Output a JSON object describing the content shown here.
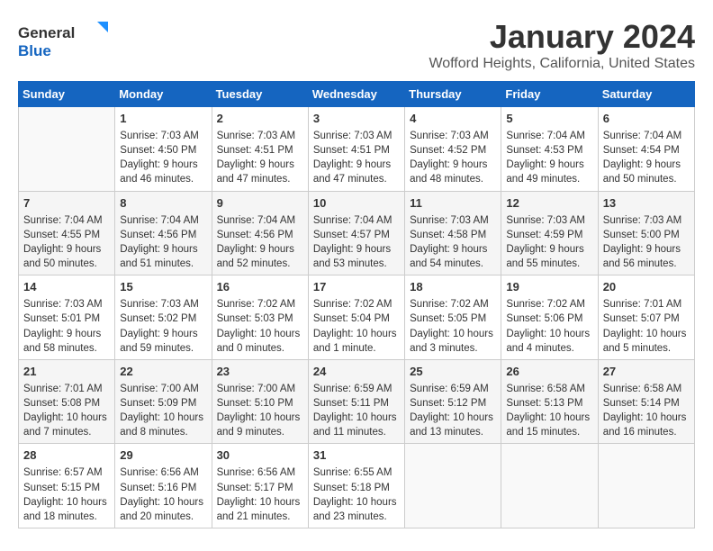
{
  "logo": {
    "general": "General",
    "blue": "Blue"
  },
  "header": {
    "title": "January 2024",
    "subtitle": "Wofford Heights, California, United States"
  },
  "weekdays": [
    "Sunday",
    "Monday",
    "Tuesday",
    "Wednesday",
    "Thursday",
    "Friday",
    "Saturday"
  ],
  "weeks": [
    [
      {
        "day": "",
        "content": ""
      },
      {
        "day": "1",
        "content": "Sunrise: 7:03 AM\nSunset: 4:50 PM\nDaylight: 9 hours\nand 46 minutes."
      },
      {
        "day": "2",
        "content": "Sunrise: 7:03 AM\nSunset: 4:51 PM\nDaylight: 9 hours\nand 47 minutes."
      },
      {
        "day": "3",
        "content": "Sunrise: 7:03 AM\nSunset: 4:51 PM\nDaylight: 9 hours\nand 47 minutes."
      },
      {
        "day": "4",
        "content": "Sunrise: 7:03 AM\nSunset: 4:52 PM\nDaylight: 9 hours\nand 48 minutes."
      },
      {
        "day": "5",
        "content": "Sunrise: 7:04 AM\nSunset: 4:53 PM\nDaylight: 9 hours\nand 49 minutes."
      },
      {
        "day": "6",
        "content": "Sunrise: 7:04 AM\nSunset: 4:54 PM\nDaylight: 9 hours\nand 50 minutes."
      }
    ],
    [
      {
        "day": "7",
        "content": "Sunrise: 7:04 AM\nSunset: 4:55 PM\nDaylight: 9 hours\nand 50 minutes."
      },
      {
        "day": "8",
        "content": "Sunrise: 7:04 AM\nSunset: 4:56 PM\nDaylight: 9 hours\nand 51 minutes."
      },
      {
        "day": "9",
        "content": "Sunrise: 7:04 AM\nSunset: 4:56 PM\nDaylight: 9 hours\nand 52 minutes."
      },
      {
        "day": "10",
        "content": "Sunrise: 7:04 AM\nSunset: 4:57 PM\nDaylight: 9 hours\nand 53 minutes."
      },
      {
        "day": "11",
        "content": "Sunrise: 7:03 AM\nSunset: 4:58 PM\nDaylight: 9 hours\nand 54 minutes."
      },
      {
        "day": "12",
        "content": "Sunrise: 7:03 AM\nSunset: 4:59 PM\nDaylight: 9 hours\nand 55 minutes."
      },
      {
        "day": "13",
        "content": "Sunrise: 7:03 AM\nSunset: 5:00 PM\nDaylight: 9 hours\nand 56 minutes."
      }
    ],
    [
      {
        "day": "14",
        "content": "Sunrise: 7:03 AM\nSunset: 5:01 PM\nDaylight: 9 hours\nand 58 minutes."
      },
      {
        "day": "15",
        "content": "Sunrise: 7:03 AM\nSunset: 5:02 PM\nDaylight: 9 hours\nand 59 minutes."
      },
      {
        "day": "16",
        "content": "Sunrise: 7:02 AM\nSunset: 5:03 PM\nDaylight: 10 hours\nand 0 minutes."
      },
      {
        "day": "17",
        "content": "Sunrise: 7:02 AM\nSunset: 5:04 PM\nDaylight: 10 hours\nand 1 minute."
      },
      {
        "day": "18",
        "content": "Sunrise: 7:02 AM\nSunset: 5:05 PM\nDaylight: 10 hours\nand 3 minutes."
      },
      {
        "day": "19",
        "content": "Sunrise: 7:02 AM\nSunset: 5:06 PM\nDaylight: 10 hours\nand 4 minutes."
      },
      {
        "day": "20",
        "content": "Sunrise: 7:01 AM\nSunset: 5:07 PM\nDaylight: 10 hours\nand 5 minutes."
      }
    ],
    [
      {
        "day": "21",
        "content": "Sunrise: 7:01 AM\nSunset: 5:08 PM\nDaylight: 10 hours\nand 7 minutes."
      },
      {
        "day": "22",
        "content": "Sunrise: 7:00 AM\nSunset: 5:09 PM\nDaylight: 10 hours\nand 8 minutes."
      },
      {
        "day": "23",
        "content": "Sunrise: 7:00 AM\nSunset: 5:10 PM\nDaylight: 10 hours\nand 9 minutes."
      },
      {
        "day": "24",
        "content": "Sunrise: 6:59 AM\nSunset: 5:11 PM\nDaylight: 10 hours\nand 11 minutes."
      },
      {
        "day": "25",
        "content": "Sunrise: 6:59 AM\nSunset: 5:12 PM\nDaylight: 10 hours\nand 13 minutes."
      },
      {
        "day": "26",
        "content": "Sunrise: 6:58 AM\nSunset: 5:13 PM\nDaylight: 10 hours\nand 15 minutes."
      },
      {
        "day": "27",
        "content": "Sunrise: 6:58 AM\nSunset: 5:14 PM\nDaylight: 10 hours\nand 16 minutes."
      }
    ],
    [
      {
        "day": "28",
        "content": "Sunrise: 6:57 AM\nSunset: 5:15 PM\nDaylight: 10 hours\nand 18 minutes."
      },
      {
        "day": "29",
        "content": "Sunrise: 6:56 AM\nSunset: 5:16 PM\nDaylight: 10 hours\nand 20 minutes."
      },
      {
        "day": "30",
        "content": "Sunrise: 6:56 AM\nSunset: 5:17 PM\nDaylight: 10 hours\nand 21 minutes."
      },
      {
        "day": "31",
        "content": "Sunrise: 6:55 AM\nSunset: 5:18 PM\nDaylight: 10 hours\nand 23 minutes."
      },
      {
        "day": "",
        "content": ""
      },
      {
        "day": "",
        "content": ""
      },
      {
        "day": "",
        "content": ""
      }
    ]
  ]
}
